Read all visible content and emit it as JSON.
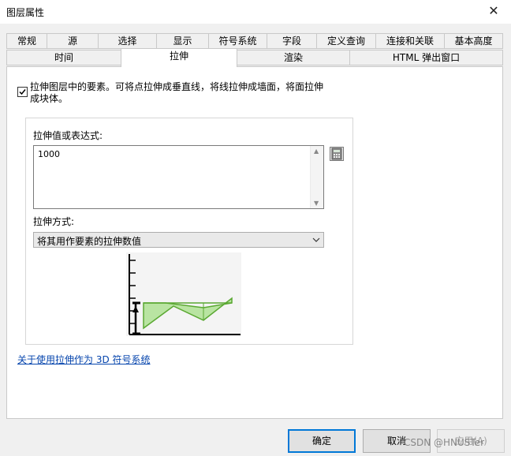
{
  "window": {
    "title": "图层属性"
  },
  "tabs_row1": [
    "常规",
    "源",
    "选择",
    "显示",
    "符号系统",
    "字段",
    "定义查询",
    "连接和关联",
    "基本高度"
  ],
  "tabs_row2": [
    "时间",
    "拉伸",
    "渲染",
    "HTML 弹出窗口"
  ],
  "active_tab": "拉伸",
  "extrusion": {
    "checkbox_label": "拉伸图层中的要素。可将点拉伸成垂直线，将线拉伸成墙面，将面拉伸成块体。",
    "checked": true,
    "value_label": "拉伸值或表达式:",
    "value": "1000",
    "method_label": "拉伸方式:",
    "method_value": "将其用作要素的拉伸数值"
  },
  "help_link": "关于使用拉伸作为 3D 符号系统",
  "buttons": {
    "ok": "确定",
    "cancel": "取消",
    "apply": "应用(A)"
  },
  "watermark": "CSDN @HNUSTer",
  "colors": {
    "accent": "#0078d7",
    "extrusion_fill": "#b9e4a2",
    "extrusion_line": "#5aa832",
    "link": "#0645ad"
  }
}
